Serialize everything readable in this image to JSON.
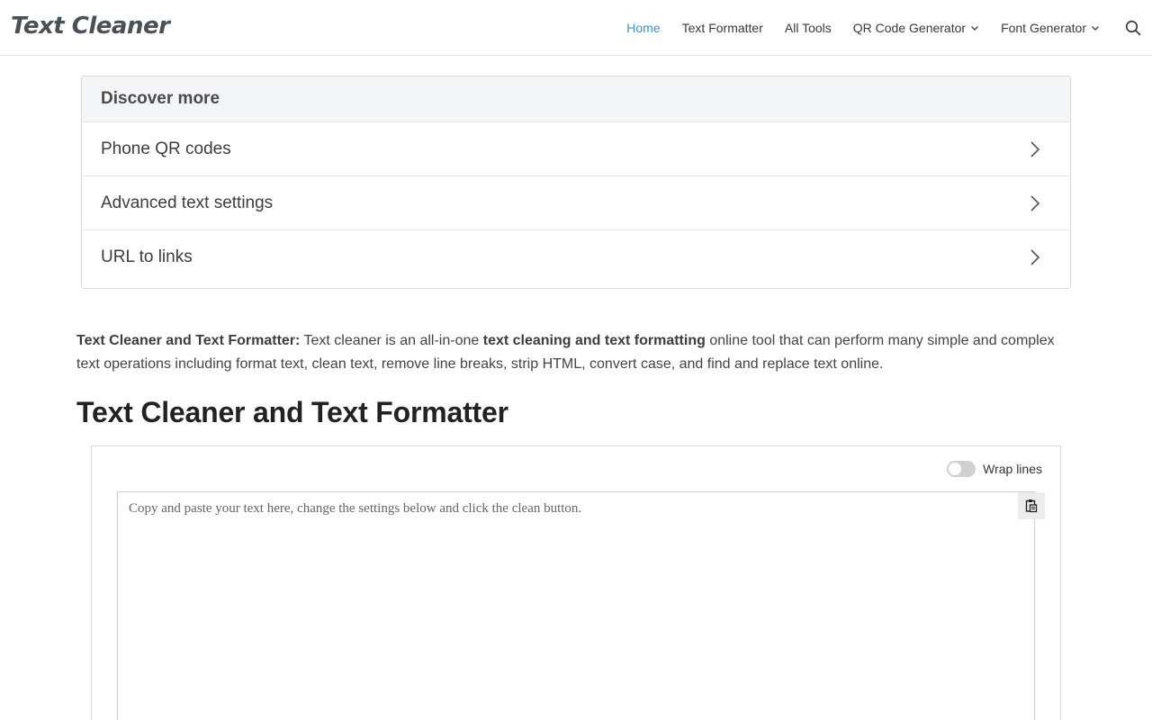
{
  "header": {
    "logo": "Text Cleaner",
    "nav": [
      {
        "label": "Home",
        "active": true,
        "dropdown": false
      },
      {
        "label": "Text Formatter",
        "active": false,
        "dropdown": false
      },
      {
        "label": "All Tools",
        "active": false,
        "dropdown": false
      },
      {
        "label": "QR Code Generator",
        "active": false,
        "dropdown": true
      },
      {
        "label": "Font Generator",
        "active": false,
        "dropdown": true
      }
    ],
    "search_icon": "search-icon"
  },
  "discover": {
    "title": "Discover more",
    "items": [
      {
        "label": "Phone QR codes"
      },
      {
        "label": "Advanced text settings"
      },
      {
        "label": "URL to links"
      }
    ]
  },
  "intro": {
    "lead": "Text Cleaner and Text Formatter:",
    "text1": " Text cleaner is an all-in-one ",
    "bold": "text cleaning and text formatting",
    "text2": " online tool that can perform many simple and complex text operations including format text, clean text, remove line breaks, strip HTML, convert case, and find and replace text online."
  },
  "main": {
    "heading": "Text Cleaner and Text Formatter"
  },
  "tool": {
    "wrap_label": "Wrap lines",
    "wrap_enabled": false,
    "input_placeholder": "Copy and paste your text here, change the settings below and click the clean button.",
    "input_value": "",
    "paste_icon": "paste-icon"
  },
  "colors": {
    "accent": "#3c8fd6",
    "logo": "#4a5056",
    "toggle_off": "#d0d0d0"
  }
}
